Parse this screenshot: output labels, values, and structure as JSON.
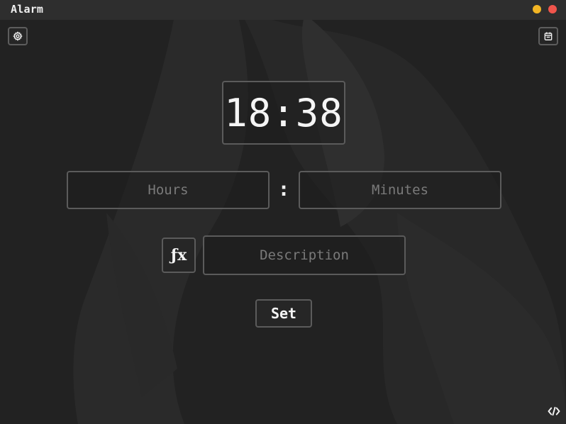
{
  "window": {
    "title": "Alarm",
    "controls": [
      "minimize-icon",
      "close-icon"
    ],
    "colors": {
      "minimize": "#f2b524",
      "close": "#f1554c",
      "background": "#232323"
    }
  },
  "toolbar": {
    "settings_icon": "gear-icon",
    "calendar_icon": "calendar-icon"
  },
  "clock": {
    "time": "18:38"
  },
  "time_input": {
    "hours_placeholder": "Hours",
    "hours_value": "",
    "separator": ":",
    "minutes_placeholder": "Minutes",
    "minutes_value": ""
  },
  "description": {
    "fx_label": "ƒx",
    "placeholder": "Description",
    "value": ""
  },
  "actions": {
    "set_label": "Set"
  },
  "footer": {
    "code_icon": "code-icon"
  }
}
